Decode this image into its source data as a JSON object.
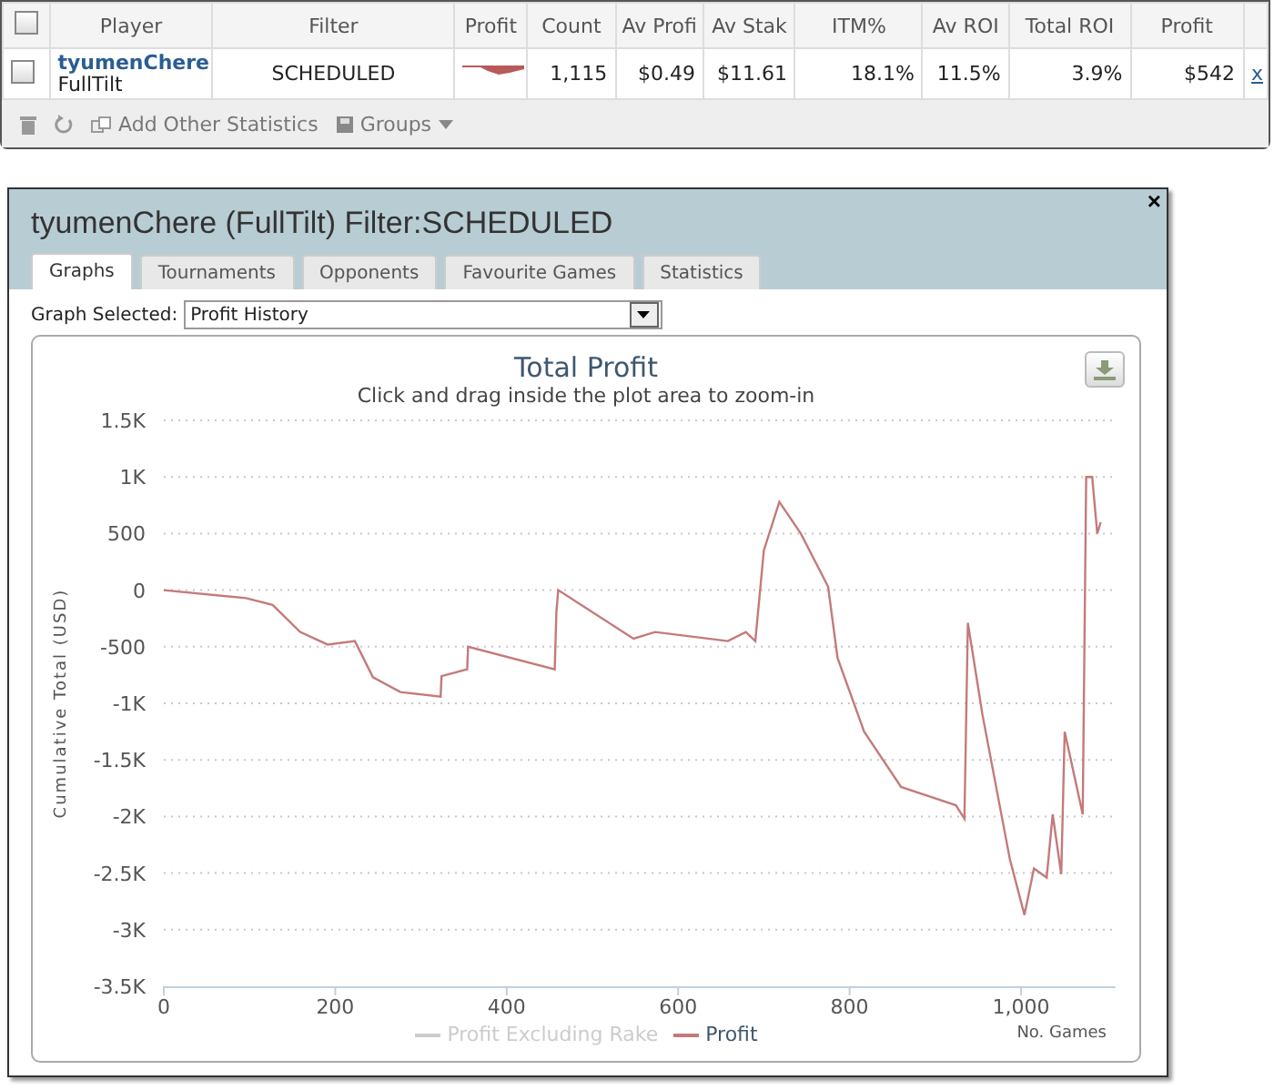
{
  "stats_table": {
    "header_checkbox": {
      "checked": false
    },
    "columns": [
      "Player",
      "Filter",
      "Profit",
      "Count",
      "Av Profi",
      "Av Stak",
      "ITM%",
      "Av ROI",
      "Total ROI",
      "Profit"
    ],
    "rows": [
      {
        "checked": false,
        "player": "tyumenChere",
        "site": "FullTilt",
        "filter": "SCHEDULED",
        "values": [
          "1,115",
          "$0.49",
          "$11.61",
          "18.1%",
          "11.5%",
          "3.9%",
          "$542"
        ],
        "remove": "x"
      }
    ],
    "toolbar": [
      {
        "kind": "delete"
      },
      {
        "kind": "refresh"
      },
      {
        "kind": "add",
        "label": "Add Other Statistics"
      },
      {
        "kind": "menu",
        "label": "Groups"
      }
    ]
  },
  "dialog": {
    "title": "tyumenChere (FullTilt) Filter:SCHEDULED",
    "close": "×",
    "tabs": [
      {
        "label": "Graphs",
        "selected": true
      },
      {
        "label": "Tournaments",
        "selected": false
      },
      {
        "label": "Opponents",
        "selected": false
      },
      {
        "label": "Favourite Games",
        "selected": false
      },
      {
        "label": "Statistics",
        "selected": false
      }
    ],
    "graph_select": {
      "label": "Graph Selected:",
      "value": "Profit History"
    },
    "chart": {
      "subtitle": "Click and drag inside the plot area to zoom-in",
      "chart_data": {
        "type": "line",
        "title": "Total Profit",
        "xlabel": "No. Games",
        "ylabel": "Cumulative Total (USD)",
        "grid": true,
        "xlim": [
          0,
          1110
        ],
        "ylim": [
          -3500,
          1500
        ],
        "xticks": [
          0,
          200,
          400,
          600,
          800,
          {
            "value": 1000,
            "label": "1,000"
          }
        ],
        "yticks": [
          {
            "value": 1500,
            "label": "1.5K"
          },
          {
            "value": 1000,
            "label": "1K"
          },
          500,
          0,
          -500,
          {
            "value": -1000,
            "label": "-1K"
          },
          {
            "value": -1500,
            "label": "-1.5K"
          },
          {
            "value": -2000,
            "label": "-2K"
          },
          {
            "value": -2500,
            "label": "-2.5K"
          },
          {
            "value": -3000,
            "label": "-3K"
          },
          {
            "value": -3500,
            "label": "-3.5K"
          }
        ],
        "x": [
          0,
          96,
          127,
          159,
          191,
          223,
          244,
          276,
          323,
          324,
          354,
          355,
          456,
          458,
          460,
          548,
          573,
          658,
          679,
          690,
          700,
          718,
          743,
          775,
          786,
          817,
          860,
          924,
          934,
          938,
          955,
          987,
          1004,
          1015,
          1030,
          1037,
          1047,
          1051,
          1072,
          1076,
          1083,
          1089,
          1093
        ],
        "series": [
          {
            "name": "Profit",
            "color": "#c47a7a",
            "values": [
              0,
              -70,
              -130,
              -370,
              -480,
              -450,
              -770,
              -900,
              -940,
              -760,
              -700,
              -500,
              -700,
              -200,
              0,
              -430,
              -370,
              -450,
              -370,
              -450,
              350,
              780,
              500,
              30,
              -600,
              -1250,
              -1740,
              -1900,
              -2020,
              -290,
              -1100,
              -2380,
              -2870,
              -2460,
              -2540,
              -1980,
              -2510,
              -1250,
              -1980,
              1000,
              1000,
              500,
              600
            ]
          }
        ]
      },
      "hidden_legend": [
        {
          "label": "Profit Excluding Rake",
          "enabled": false,
          "color": "#cccccc"
        }
      ]
    }
  }
}
